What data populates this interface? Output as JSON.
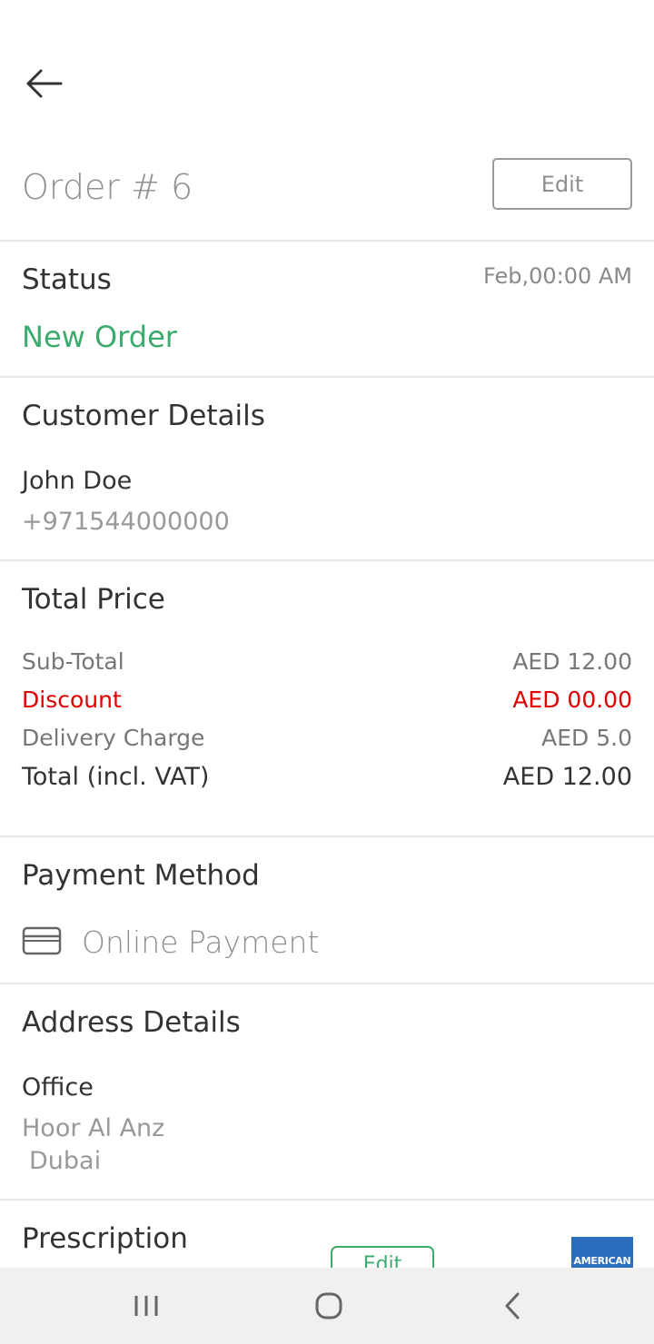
{
  "header": {
    "order_title": "Order # 6",
    "edit_label": "Edit"
  },
  "status": {
    "title": "Status",
    "time": "Feb,00:00 AM",
    "value": "New Order"
  },
  "customer": {
    "title": "Customer Details",
    "name": "John Doe",
    "phone": "+971544000000"
  },
  "price": {
    "title": "Total Price",
    "rows": [
      {
        "label": "Sub-Total",
        "value": "AED 12.00"
      },
      {
        "label": "Discount",
        "value": "AED 00.00"
      },
      {
        "label": "Delivery Charge",
        "value": "AED 5.0"
      },
      {
        "label": "Total (incl. VAT)",
        "value": "AED 12.00"
      }
    ]
  },
  "payment": {
    "title": "Payment Method",
    "method": "Online Payment",
    "icon": "credit-card-icon"
  },
  "address": {
    "title": "Address Details",
    "label": "Office",
    "line1": "Hoor Al Anz",
    "line2": "Dubai"
  },
  "prescription": {
    "title": "Prescription",
    "edit_label": "Edit",
    "logo_text": "AMERICAN"
  },
  "colors": {
    "accent_green": "#3daa6e",
    "discount_red": "#e00000",
    "divider": "#e3e8ec"
  },
  "navbar": {
    "icons": [
      "recent-apps-icon",
      "home-icon",
      "back-nav-icon"
    ]
  }
}
